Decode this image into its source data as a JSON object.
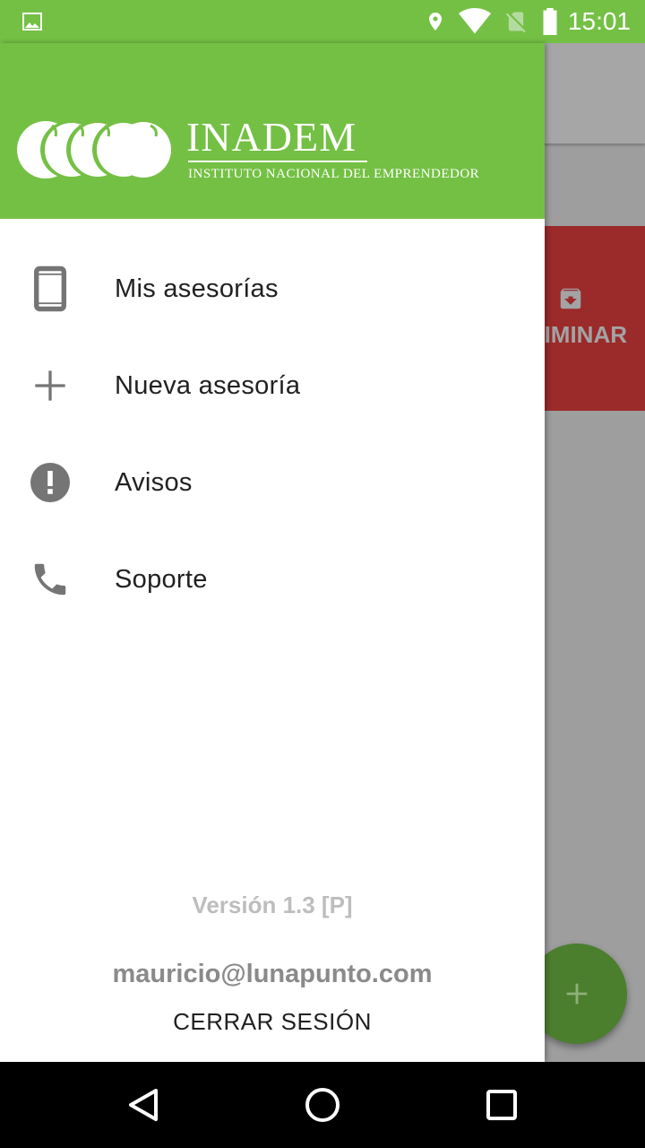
{
  "status_bar": {
    "time": "15:01",
    "icons": [
      "gallery-icon",
      "location-icon",
      "wifi-icon",
      "no-sim-icon",
      "battery-icon"
    ]
  },
  "background": {
    "card_action_label": "IMINAR",
    "card_action_icon": "archive-icon",
    "fab_icon": "plus-icon"
  },
  "drawer": {
    "header": {
      "logo_name": "INADEM",
      "logo_subtitle": "INSTITUTO NACIONAL DEL EMPRENDEDOR"
    },
    "menu": [
      {
        "label": "Mis asesorías",
        "icon": "phone-device-icon"
      },
      {
        "label": "Nueva asesoría",
        "icon": "plus-icon"
      },
      {
        "label": "Avisos",
        "icon": "alert-circle-icon"
      },
      {
        "label": "Soporte",
        "icon": "phone-call-icon"
      }
    ],
    "version": "Versión 1.3 [P]",
    "email": "mauricio@lunapunto.com",
    "logout_label": "CERRAR SESIÓN"
  },
  "nav_bar": {
    "buttons": [
      "back-icon",
      "home-icon",
      "recents-icon"
    ]
  },
  "colors": {
    "brand_green": "#74c044",
    "card_red": "#9b2a2a",
    "fab_green": "#4b7f2e",
    "scrim": "#9e9e9e"
  }
}
